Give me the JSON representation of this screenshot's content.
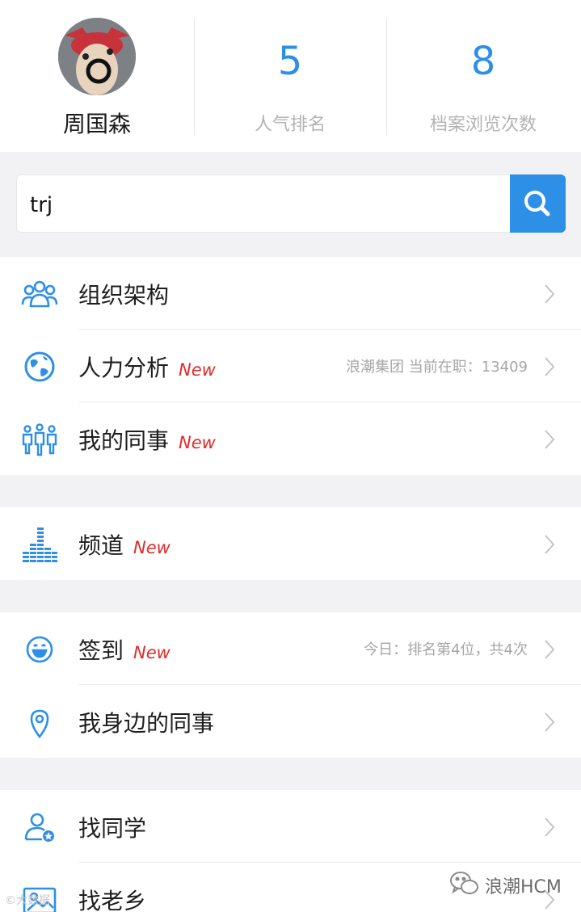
{
  "profile": {
    "name": "周国森"
  },
  "stats": [
    {
      "value": "5",
      "label": "人气排名"
    },
    {
      "value": "8",
      "label": "档案浏览次数"
    }
  ],
  "search": {
    "value": "trj"
  },
  "groups": [
    {
      "items": [
        {
          "label": "组织架构",
          "icon": "organization-icon"
        },
        {
          "label": "人力分析",
          "badge": "New",
          "info": "浪潮集团 当前在职：13409",
          "icon": "globe-icon"
        },
        {
          "label": "我的同事",
          "badge": "New",
          "icon": "colleagues-icon"
        }
      ]
    },
    {
      "items": [
        {
          "label": "频道",
          "badge": "New",
          "icon": "channel-bars-icon"
        }
      ]
    },
    {
      "items": [
        {
          "label": "签到",
          "badge": "New",
          "info": "今日：排名第4位，共4次",
          "icon": "smiley-icon"
        },
        {
          "label": "我身边的同事",
          "icon": "location-pin-icon"
        }
      ]
    },
    {
      "items": [
        {
          "label": "找同学",
          "icon": "find-classmate-icon"
        },
        {
          "label": "找老乡",
          "icon": "find-hometown-icon"
        }
      ]
    }
  ],
  "watermark": {
    "right": "浪潮HCM",
    "left": "©大数据"
  },
  "colors": {
    "accent": "#2d8fe6",
    "new_badge": "#e02b2b"
  }
}
